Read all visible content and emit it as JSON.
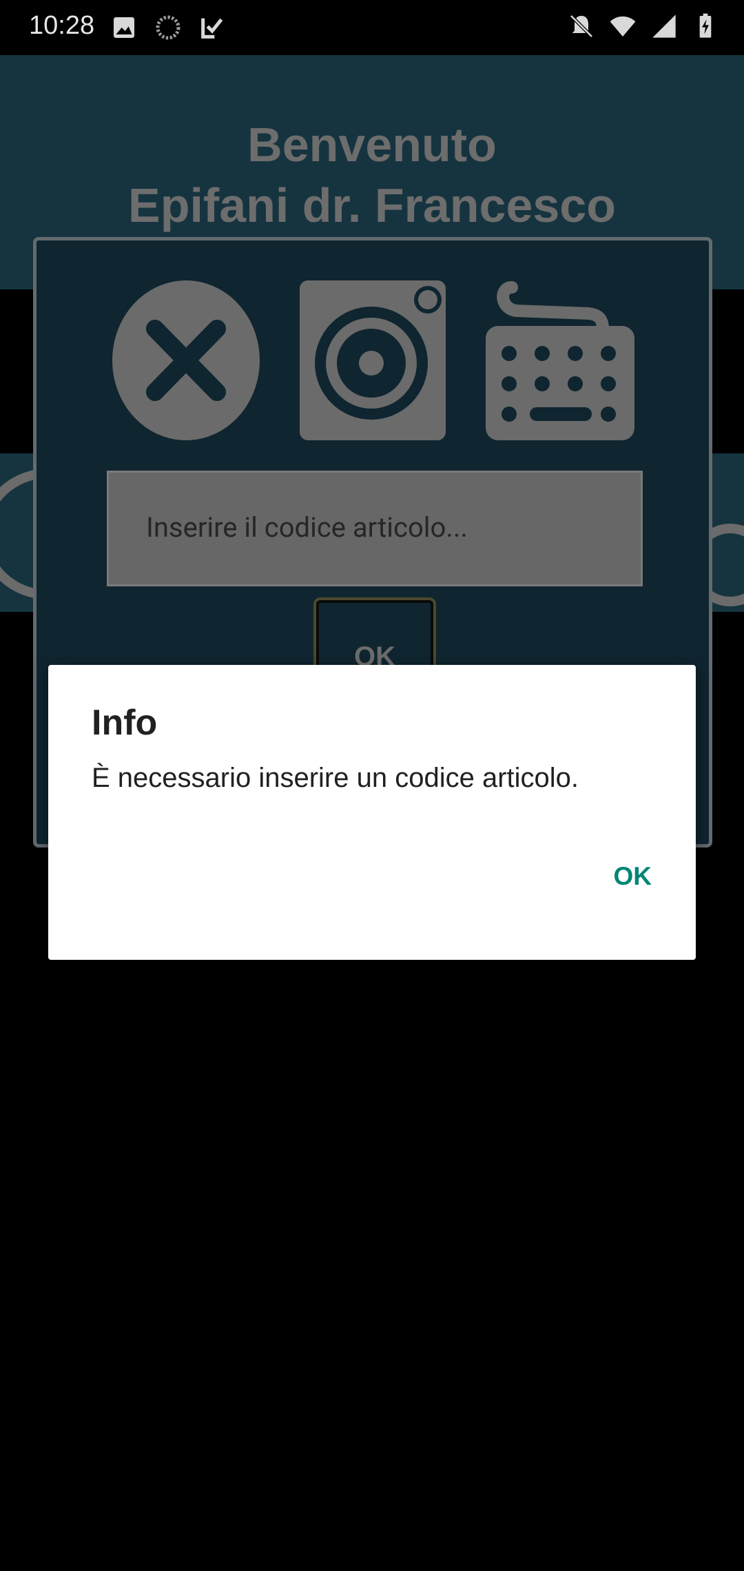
{
  "status_bar": {
    "time": "10:28",
    "left_icons": [
      "image-icon",
      "sync-icon",
      "check-icon"
    ],
    "right_icons": [
      "notifications-off-icon",
      "wifi-icon",
      "signal-icon",
      "battery-charging-icon"
    ]
  },
  "header": {
    "line1": "Benvenuto",
    "line2": "Epifani dr. Francesco"
  },
  "panel": {
    "icons": [
      "close-circle-icon",
      "camera-scan-icon",
      "keyboard-icon"
    ],
    "input_placeholder": "Inserire il codice articolo...",
    "ok_label": "OK"
  },
  "dialog": {
    "title": "Info",
    "message": "È necessario inserire un codice articolo.",
    "ok_label": "OK"
  },
  "colors": {
    "accent": "#008577",
    "app_background": "#16343f",
    "dimmed_gray": "#6d6d6d"
  }
}
